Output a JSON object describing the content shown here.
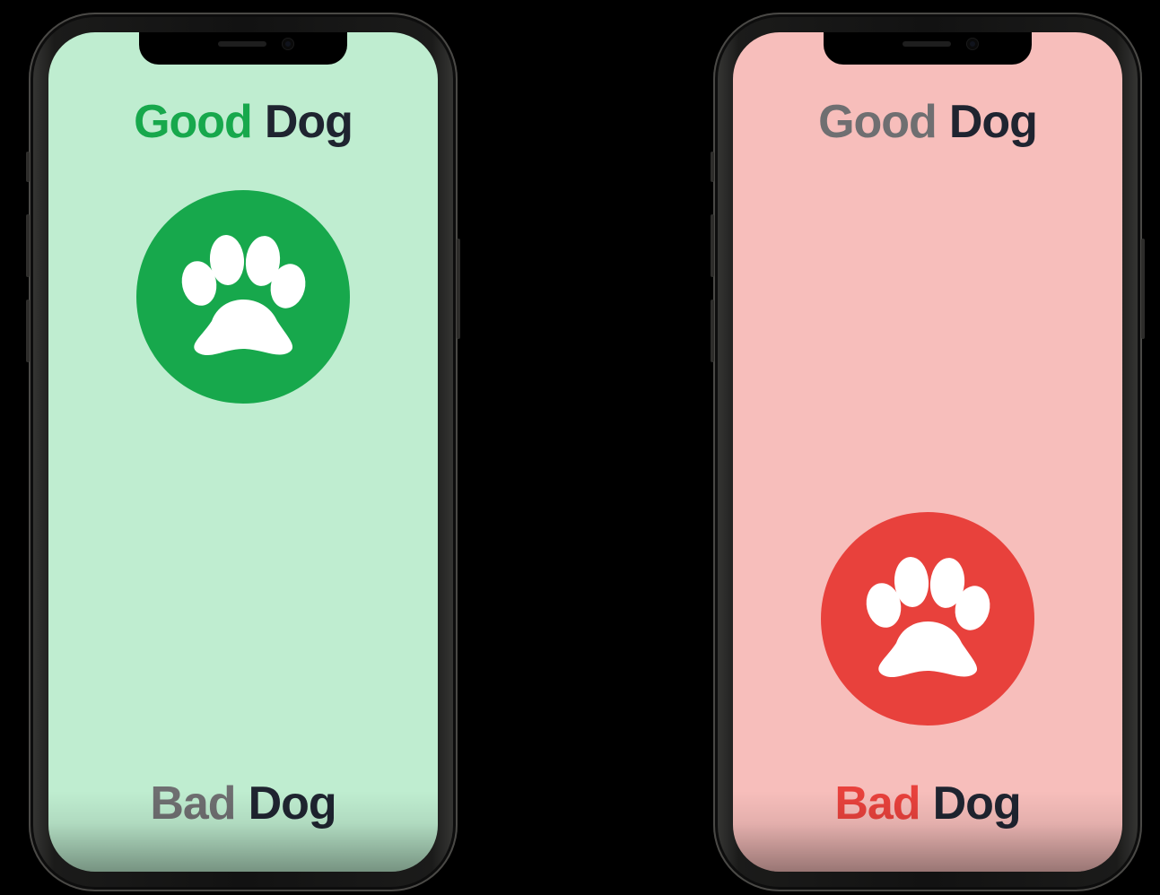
{
  "colors": {
    "good_green": "#17a84c",
    "good_screen_bg": "#bfedd0",
    "bad_red": "#e8413c",
    "bad_screen_bg": "#f7bebb",
    "inactive_gray": "#6f6f71",
    "dark_text": "#1f2430",
    "paw_white": "#ffffff"
  },
  "phones": [
    {
      "state": "good",
      "top_label": {
        "word1": "Good",
        "word2": "Dog"
      },
      "bottom_label": {
        "word1": "Bad",
        "word2": "Dog"
      },
      "icon": "paw-icon"
    },
    {
      "state": "bad",
      "top_label": {
        "word1": "Good",
        "word2": "Dog"
      },
      "bottom_label": {
        "word1": "Bad",
        "word2": "Dog"
      },
      "icon": "paw-icon"
    }
  ]
}
